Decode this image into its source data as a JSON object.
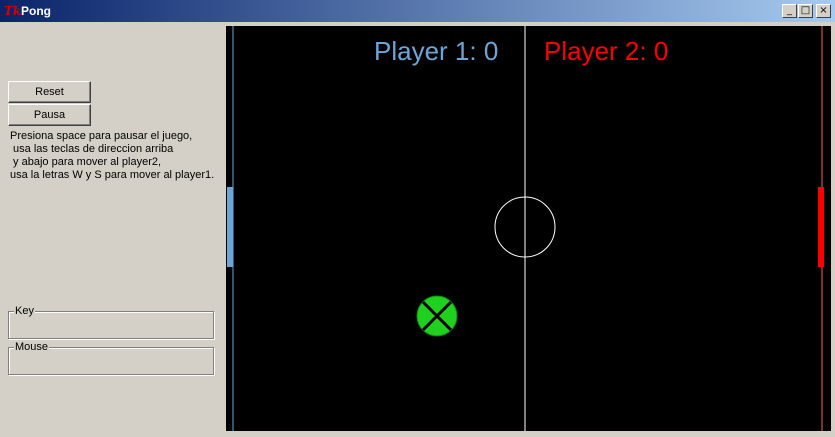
{
  "window": {
    "title": "Pong",
    "logo": "tk-logo",
    "controls": {
      "minimize": "_",
      "maximize": "□",
      "close": "×"
    }
  },
  "controls": {
    "reset_label": "Reset",
    "pause_label": "Pausa"
  },
  "instructions": "Presiona space para pausar el juego,\n usa las teclas de direccion arriba\n y abajo para mover al player2,\nusa la letras W y S para mover al player1.",
  "frames": {
    "key_label": "Key",
    "mouse_label": "Mouse"
  },
  "game": {
    "player1_score": "Player 1: 0",
    "player2_score": "Player 2: 0",
    "colors": {
      "background": "#000000",
      "player1": "#6ca6d9",
      "player2": "#ff0000",
      "ball": "#1fd01f",
      "lines": "#ffffff"
    }
  }
}
